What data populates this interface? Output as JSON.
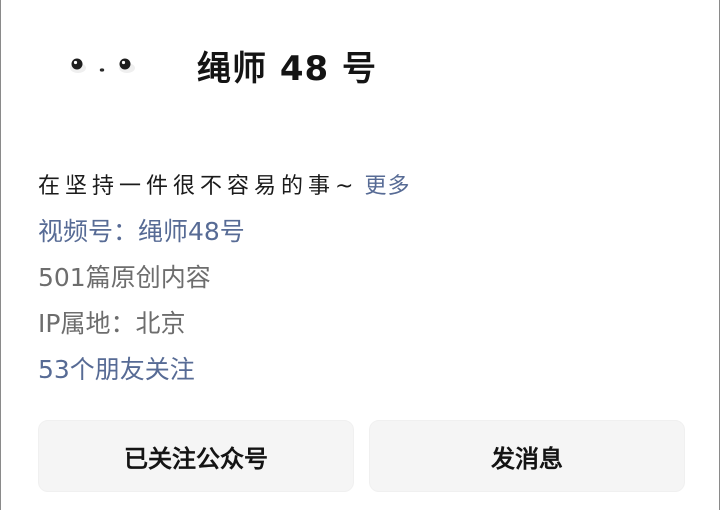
{
  "profile": {
    "avatar_icon": "kaomoji-face-avatar-icon",
    "name": "绳师 48 号",
    "bio": "在坚持一件很不容易的事~",
    "more_label": "更多",
    "channel": "视频号：绳师48号",
    "original_count": "501篇原创内容",
    "ip_location": "IP属地：北京",
    "friends_following": "53个朋友关注"
  },
  "actions": {
    "followed_label": "已关注公众号",
    "message_label": "发消息"
  },
  "colors": {
    "link": "#576b95",
    "text_primary": "#141414",
    "text_secondary": "#6d6d6d",
    "button_bg": "#f5f5f5"
  }
}
